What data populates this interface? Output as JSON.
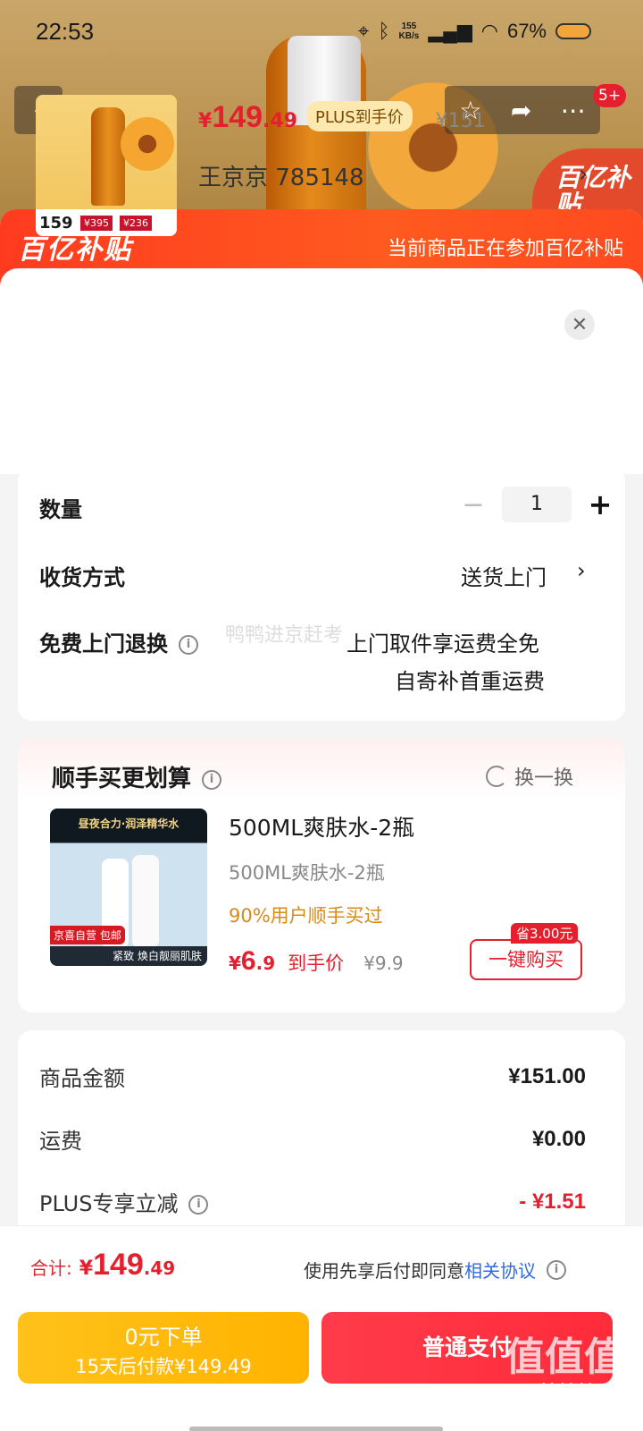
{
  "status": {
    "time": "22:53",
    "net_speed_top": "155",
    "net_speed_bottom": "KB/s",
    "battery": "67%"
  },
  "nav": {
    "badge": "5+"
  },
  "hero": {
    "corner_badge": "百亿补贴"
  },
  "banner": {
    "logo": "百亿补贴",
    "message": "当前商品正在参加百亿补贴"
  },
  "product": {
    "thumb_price": "159",
    "thumb_price_b": "¥395",
    "thumb_price_c": "¥236",
    "currency": "¥",
    "price_int": "149",
    "price_dec": ".49",
    "plus_tag": "PLUS到手价",
    "original_price": "¥151",
    "seller": "王京京  785148"
  },
  "options": {
    "quantity_label": "数量",
    "quantity": "1",
    "delivery_label": "收货方式",
    "delivery_value": "送货上门",
    "return_label": "免费上门退换",
    "return_line1": "上门取件享运费全免",
    "return_line2": "自寄补首重运费",
    "watermark": "鸭鸭进京赶考"
  },
  "recommend": {
    "title": "顺手买更划算",
    "refresh": "换一换",
    "img_title": "昼夜合力·润泽精华水",
    "img_label": "京喜自营 包邮",
    "img_footer": "紧致 焕白靓丽肌肤",
    "name": "500ML爽肤水-2瓶",
    "spec": "500ML爽肤水-2瓶",
    "popularity": "90%用户顺手买过",
    "currency": "¥",
    "price_int": "6",
    "price_dec": ".9",
    "price_label": "到手价",
    "original": "¥9.9",
    "save_tag": "省3.00元",
    "buy_label": "一键购买"
  },
  "summary": {
    "items": [
      {
        "label": "商品金额",
        "value": "¥151.00"
      },
      {
        "label": "运费",
        "value": "¥0.00"
      },
      {
        "label": "PLUS专享立减",
        "value": "- ¥1.51"
      }
    ]
  },
  "bottom": {
    "total_label": "合计:",
    "currency": "¥",
    "total_int": "149",
    "total_dec": ".49",
    "agree_text": "使用先享后付即同意",
    "agree_link": "相关协议",
    "pay_later_line1": "0元下单",
    "pay_later_line2": "15天后付款¥149.49",
    "pay_now": "普通支付",
    "corner_logo": "值值值",
    "watermark_site": "zhizhizhi.com"
  },
  "colors": {
    "accent_red": "#e5202e",
    "banner_orange": "#ff4a1f",
    "pay_later_yellow": "#ffb300",
    "link_blue": "#2f6be5"
  }
}
